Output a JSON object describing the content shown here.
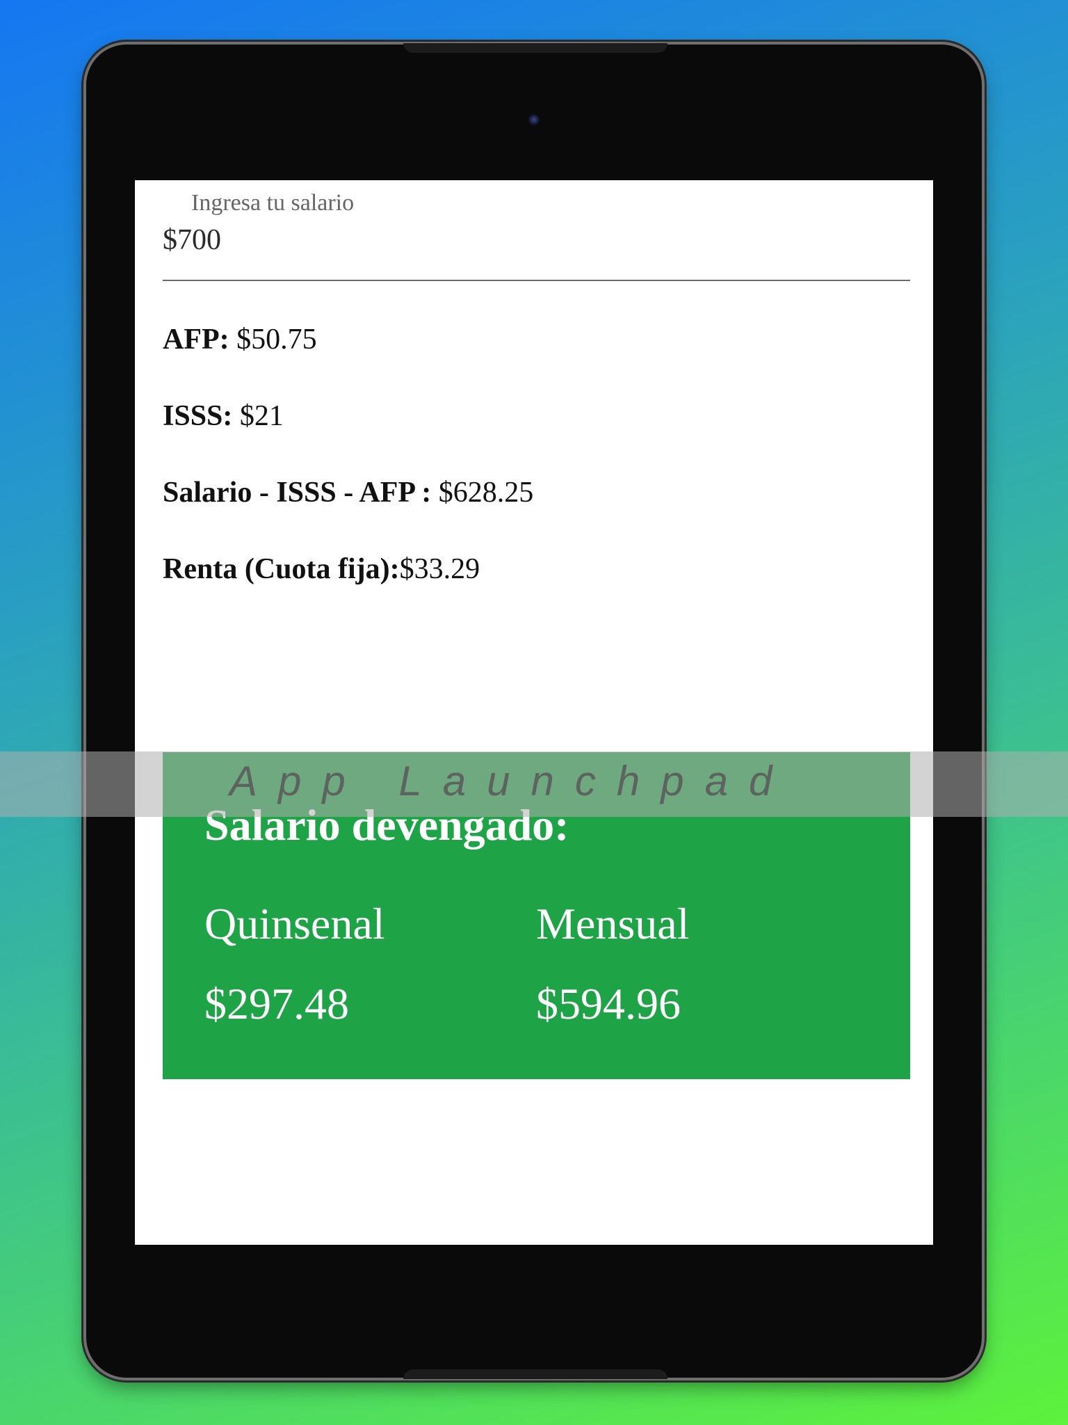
{
  "salary_input": {
    "label": "Ingresa tu salario",
    "value": "$700"
  },
  "results": {
    "afp_label": "AFP:",
    "afp_value": " $50.75",
    "isss_label": "ISSS:",
    "isss_value": " $21",
    "net_label": "Salario - ISSS - AFP :",
    "net_value": " $628.25",
    "renta_label": "Renta (Cuota fija):",
    "renta_value": "$33.29"
  },
  "accrued_card": {
    "title": "Salario devengado:",
    "biweekly_label": "Quinsenal",
    "biweekly_value": "$297.48",
    "monthly_label": "Mensual",
    "monthly_value": "$594.96",
    "background_color": "#1fa347"
  },
  "watermark": {
    "text": "App Launchpad"
  }
}
